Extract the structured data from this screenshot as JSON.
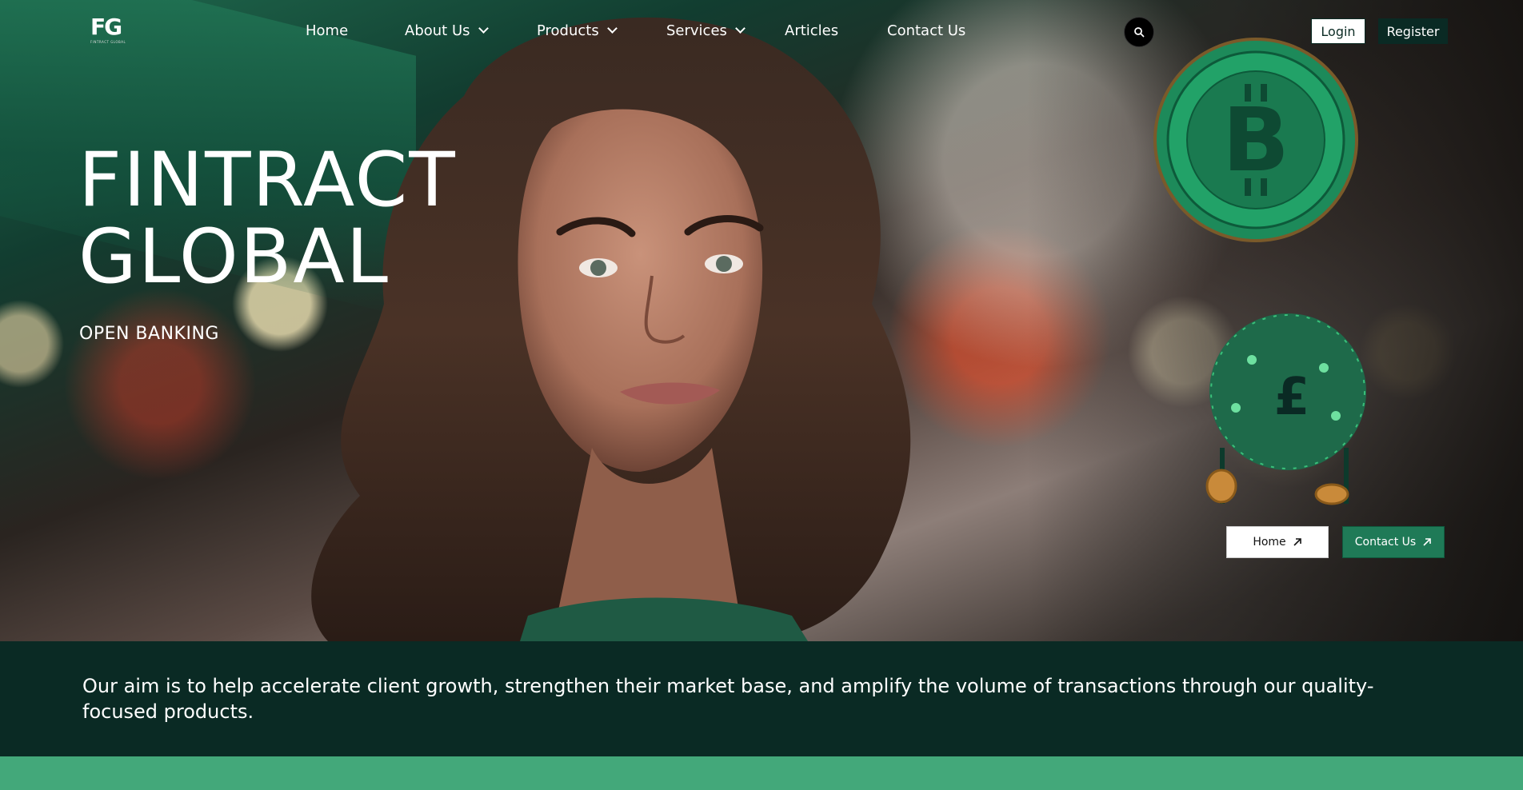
{
  "brand": {
    "logo_text": "FG",
    "logo_subtext": "FINTRACT GLOBAL"
  },
  "nav": {
    "items": [
      {
        "label": "Home",
        "has_dropdown": false
      },
      {
        "label": "About Us",
        "has_dropdown": true
      },
      {
        "label": "Products",
        "has_dropdown": true
      },
      {
        "label": "Services",
        "has_dropdown": true
      },
      {
        "label": "Articles",
        "has_dropdown": false
      },
      {
        "label": "Contact Us",
        "has_dropdown": false
      }
    ],
    "search_icon": "search-icon"
  },
  "auth": {
    "login_label": "Login",
    "register_label": "Register"
  },
  "hero": {
    "title_line1": "FINTRACT",
    "title_line2": "GLOBAL",
    "subtitle": "OPEN BANKING",
    "buttons": [
      {
        "label": "Home",
        "icon": "arrow-up-right-icon"
      },
      {
        "label": "Contact Us",
        "icon": "arrow-up-right-icon"
      }
    ]
  },
  "aim": {
    "text": "Our aim is to help accelerate client growth, strengthen their market base, and amplify the volume of transactions through our quality-focused products."
  },
  "colors": {
    "dark_green": "#0a2a24",
    "accent_green": "#1f7a57",
    "strip_green": "#43a87a",
    "white": "#ffffff"
  }
}
